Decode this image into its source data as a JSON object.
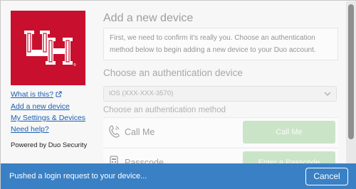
{
  "sidebar": {
    "links": [
      {
        "label": "What is this?"
      },
      {
        "label": "Add a new device"
      },
      {
        "label": "My Settings & Devices"
      },
      {
        "label": "Need help?"
      }
    ],
    "powered_by": "Powered by Duo Security",
    "logo_icon": "university-of-houston-uh-logo"
  },
  "main": {
    "title": "Add a new device",
    "info_text": "First, we need to confirm it's really you. Choose an authentication method below to begin adding a new device to your Duo account.",
    "device_heading": "Choose an authentication device",
    "device_select_value": "iOS (XXX-XXX-3570)",
    "method_heading": "Choose an authentication method",
    "methods": [
      {
        "label": "Call Me",
        "button": "Call Me",
        "icon": "phone-icon"
      },
      {
        "label": "Passcode",
        "button": "Enter a Passcode",
        "icon": "passcode-icon"
      }
    ]
  },
  "status": {
    "message": "Pushed a login request to your device...",
    "cancel_label": "Cancel"
  },
  "colors": {
    "brand_red": "#c8102e",
    "status_blue": "#3a80c4",
    "method_button_green": "#a6d6a2",
    "link_blue": "#1a5fb4"
  }
}
